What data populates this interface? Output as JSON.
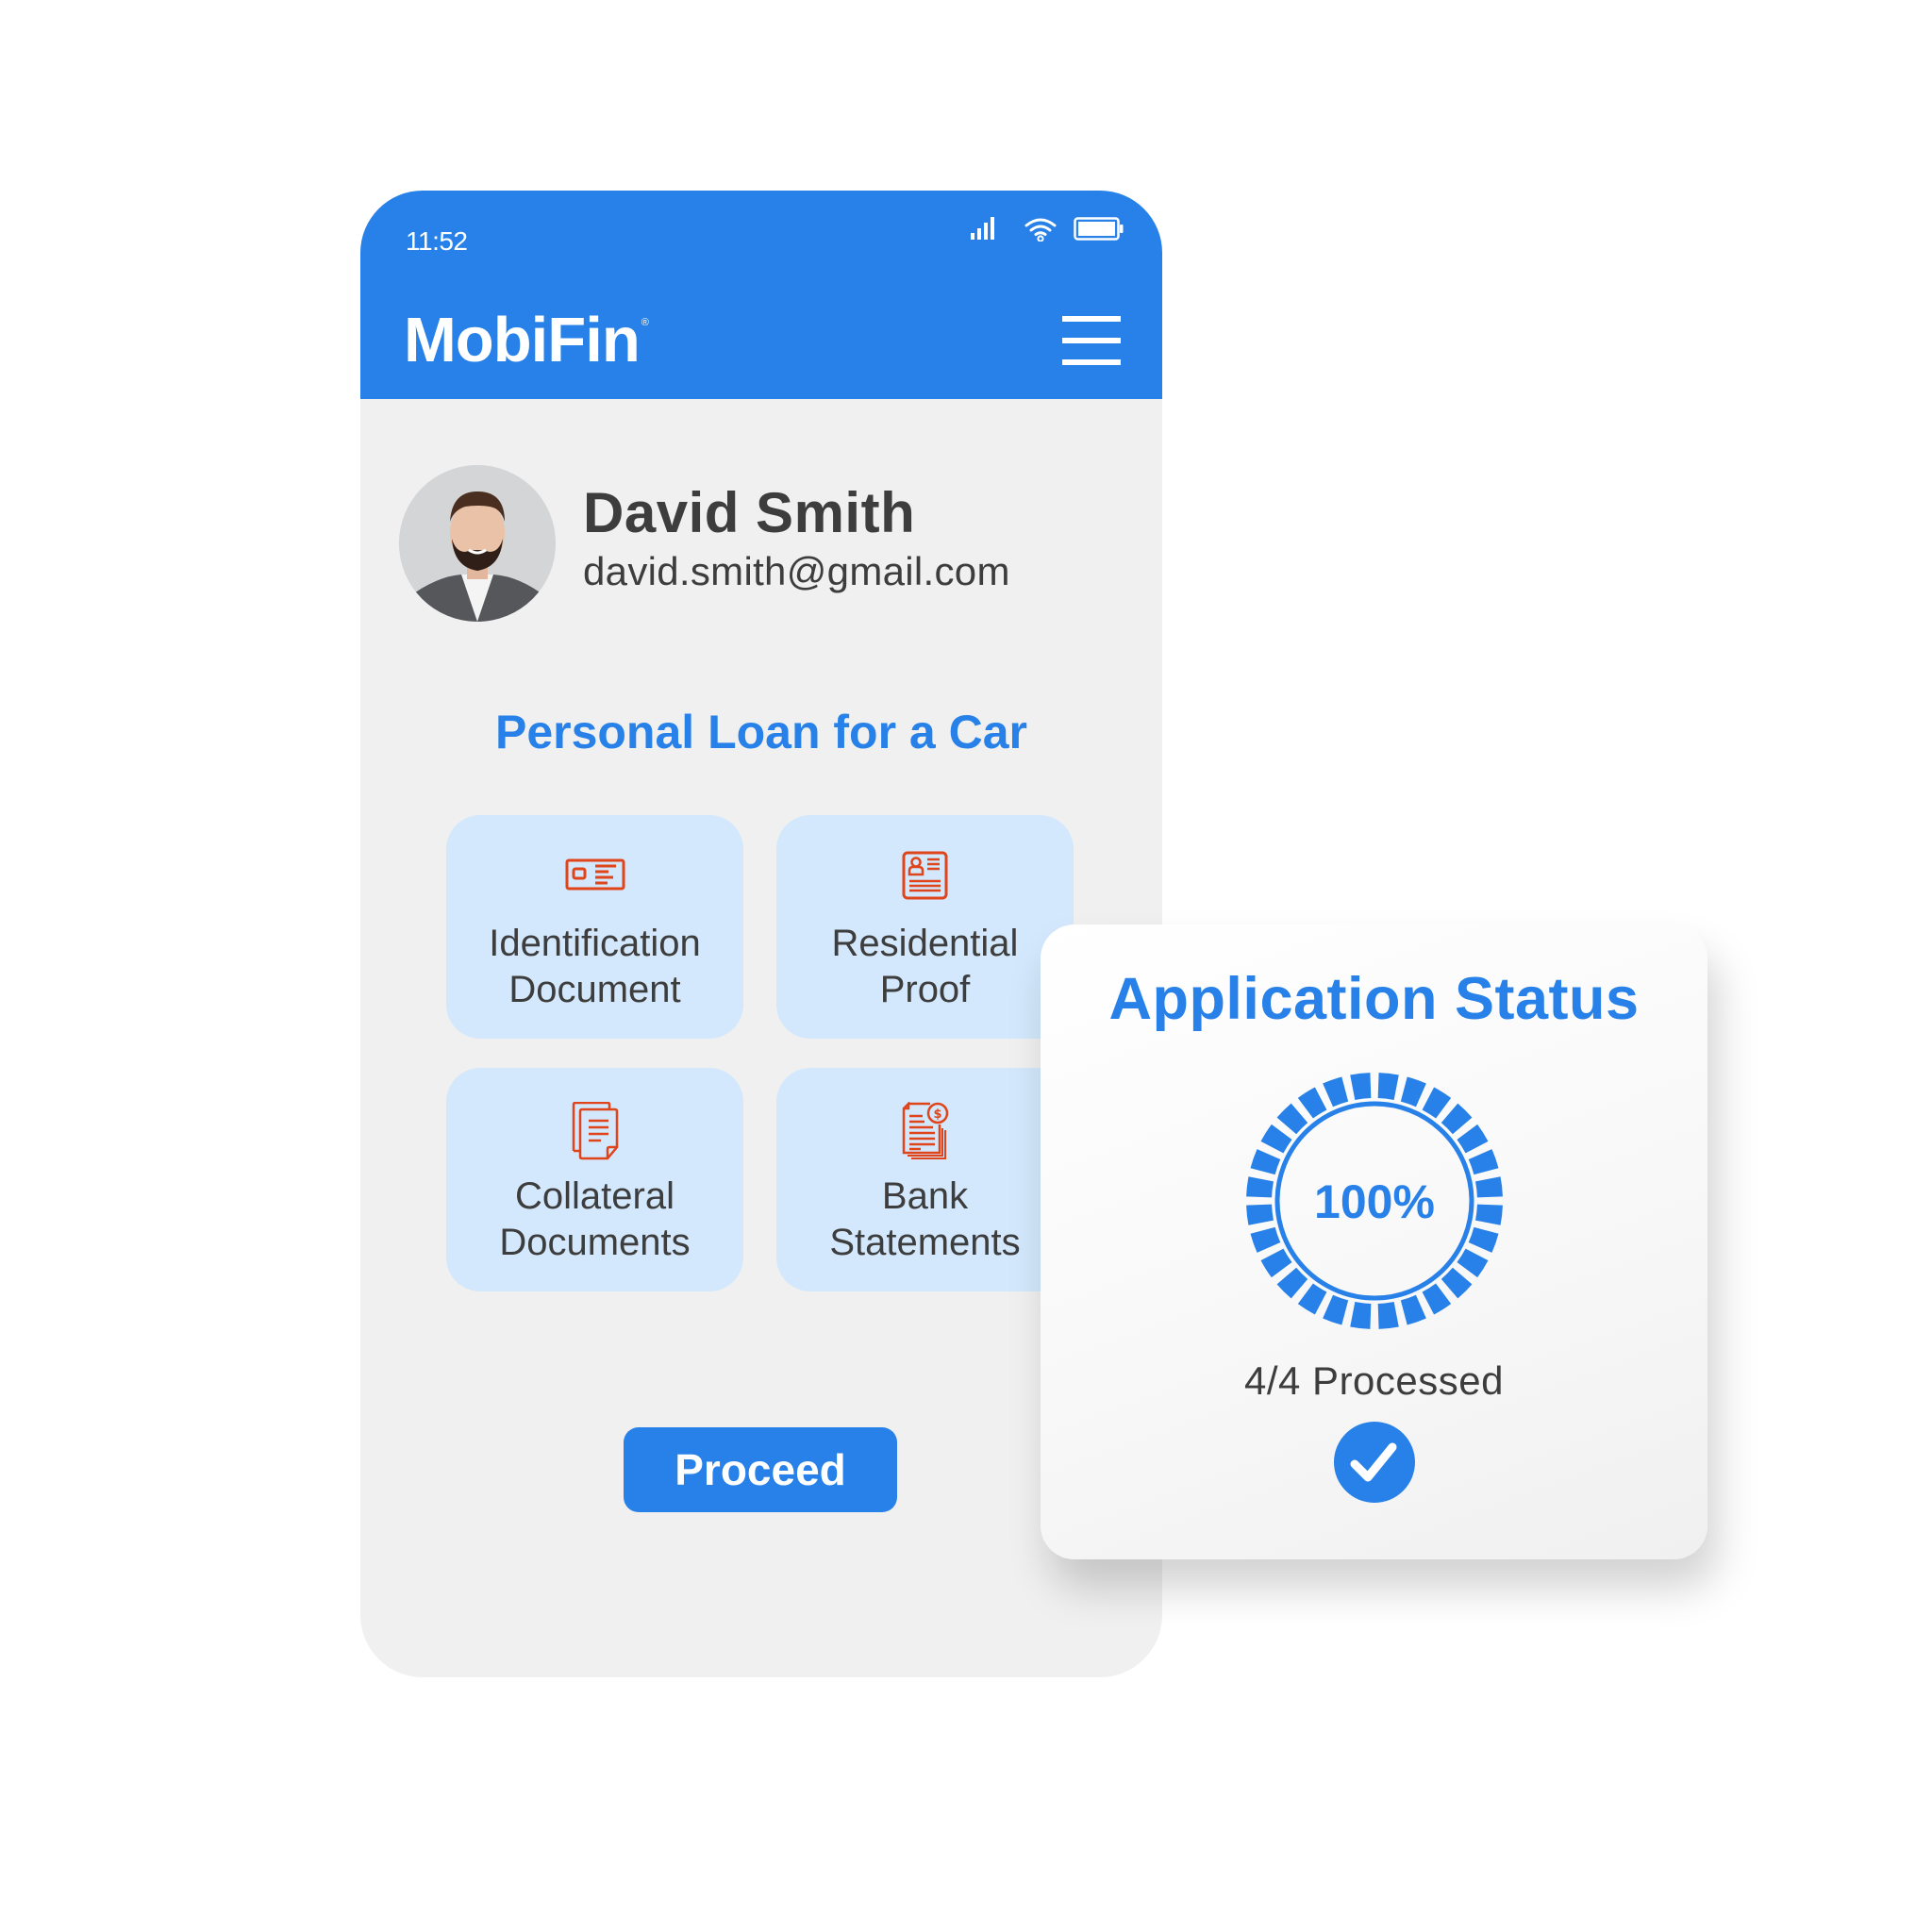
{
  "status_bar": {
    "time": "11:52",
    "icons": [
      "signal-icon",
      "wifi-icon",
      "battery-icon"
    ]
  },
  "header": {
    "logo": "MobiFin",
    "logo_mark": "®",
    "menu_icon": "hamburger-menu-icon"
  },
  "profile": {
    "name": "David Smith",
    "email": "david.smith@gmail.com",
    "avatar": "profile-photo"
  },
  "loan": {
    "title": "Personal Loan for a Car",
    "documents": [
      {
        "line1": "Identification",
        "line2": "Document",
        "icon": "id-card-icon"
      },
      {
        "line1": "Residential",
        "line2": "Proof",
        "icon": "resident-profile-icon"
      },
      {
        "line1": "Collateral",
        "line2": "Documents",
        "icon": "documents-icon"
      },
      {
        "line1": "Bank",
        "line2": "Statements",
        "icon": "bank-statement-icon"
      }
    ],
    "proceed_label": "Proceed"
  },
  "application_status": {
    "title": "Application Status",
    "progress_percent": 100,
    "progress_label": "100%",
    "processed_text": "4/4 Processed",
    "processed": 4,
    "total": 4,
    "complete_icon": "check-circle-icon"
  },
  "colors": {
    "brand_blue": "#2781e8",
    "card_bg": "#d3e8fc",
    "icon_accent": "#e0441a",
    "text_dark": "#3d3d3d",
    "phone_bg": "#f0f0f0"
  }
}
